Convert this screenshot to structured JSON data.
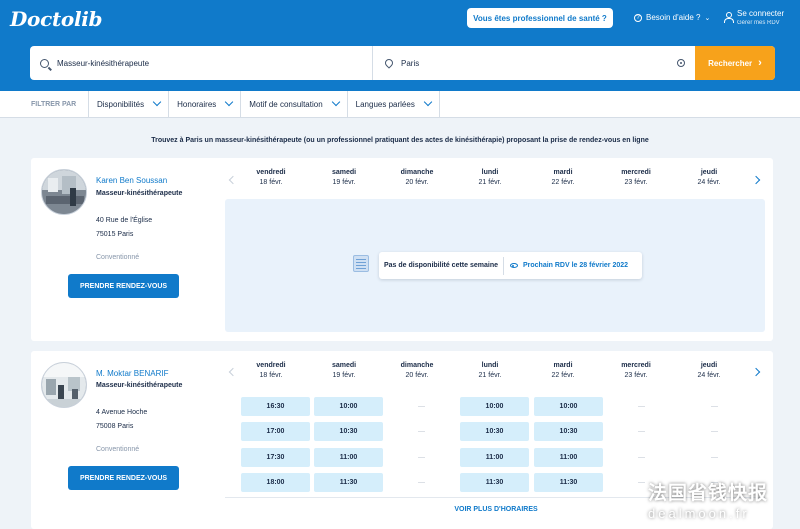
{
  "header": {
    "logo": "Doctolib",
    "pro_button": "Vous êtes professionnel de santé ?",
    "help": "Besoin d'aide ?",
    "login_title": "Se connecter",
    "login_subtitle": "Gérer mes RDV"
  },
  "search": {
    "speciality_value": "Masseur-kinésithérapeute",
    "location_value": "Paris",
    "button": "Rechercher"
  },
  "filters": {
    "label": "FILTRER PAR",
    "items": [
      "Disponibilités",
      "Honoraires",
      "Motif de consultation",
      "Langues parlées"
    ]
  },
  "intro": "Trouvez à Paris un masseur-kinésithérapeute (ou un professionnel pratiquant des actes de kinésithérapie) proposant la prise de rendez-vous en ligne",
  "days": [
    {
      "name": "vendredi",
      "date": "18 févr."
    },
    {
      "name": "samedi",
      "date": "19 févr."
    },
    {
      "name": "dimanche",
      "date": "20 févr."
    },
    {
      "name": "lundi",
      "date": "21 févr."
    },
    {
      "name": "mardi",
      "date": "22 févr."
    },
    {
      "name": "mercredi",
      "date": "23 févr."
    },
    {
      "name": "jeudi",
      "date": "24 févr."
    }
  ],
  "practitioners": [
    {
      "name": "Karen Ben Soussan",
      "speciality": "Masseur-kinésithérapeute",
      "address_line1": "40 Rue de l'Église",
      "address_line2": "75015 Paris",
      "convention": "Conventionné",
      "book_button": "PRENDRE RENDEZ-VOUS",
      "no_availability": "Pas de disponibilité cette semaine",
      "next_appointment": "Prochain RDV le 28 février 2022"
    },
    {
      "name": "M. Moktar BENARIF",
      "speciality": "Masseur-kinésithérapeute",
      "address_line1": "4 Avenue Hoche",
      "address_line2": "75008 Paris",
      "convention": "Conventionné",
      "book_button": "PRENDRE RENDEZ-VOUS",
      "slots": [
        [
          "16:30",
          "17:00",
          "17:30",
          "18:00"
        ],
        [
          "10:00",
          "10:30",
          "11:00",
          "11:30"
        ],
        [
          "—",
          "—",
          "—",
          "—"
        ],
        [
          "10:00",
          "10:30",
          "11:00",
          "11:30"
        ],
        [
          "10:00",
          "10:30",
          "11:00",
          "11:30"
        ],
        [
          "—",
          "—",
          "—",
          "—"
        ],
        [
          "—",
          "—",
          "—",
          "—"
        ]
      ],
      "more_button": "VOIR PLUS D'HORAIRES"
    }
  ],
  "watermark": {
    "line1": "法国省钱快报",
    "line2": "dealmoon.fr"
  }
}
